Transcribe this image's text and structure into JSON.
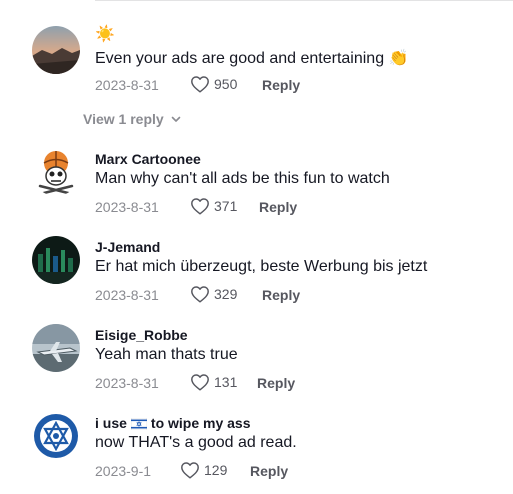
{
  "comments": [
    {
      "username_emoji": "☀️",
      "text": "Even your ads are good and entertaining 👏",
      "date": "2023-8-31",
      "likes": "950",
      "reply_label": "Reply",
      "view_replies_label": "View 1 reply"
    },
    {
      "username": "Marx Cartoonee",
      "text": "Man why can't all ads be this fun to watch",
      "date": "2023-8-31",
      "likes": "371",
      "reply_label": "Reply"
    },
    {
      "username": "J-Jemand",
      "text": "Er hat mich überzeugt, beste Werbung bis jetzt",
      "date": "2023-8-31",
      "likes": "329",
      "reply_label": "Reply"
    },
    {
      "username": "Eisige_Robbe",
      "text": "Yeah man thats true",
      "date": "2023-8-31",
      "likes": "131",
      "reply_label": "Reply"
    },
    {
      "username_prefix": "i use",
      "username_suffix": "to wipe my ass",
      "flag_icon": "israel-flag-icon",
      "text": "now THAT's a good ad read.",
      "date": "2023-9-1",
      "likes": "129",
      "reply_label": "Reply"
    }
  ],
  "icons": {
    "like": "heart-outline-icon",
    "expand": "chevron-down-icon"
  },
  "colors": {
    "text_primary": "#161823",
    "text_secondary": "#8a8b91",
    "action": "#56575f"
  }
}
